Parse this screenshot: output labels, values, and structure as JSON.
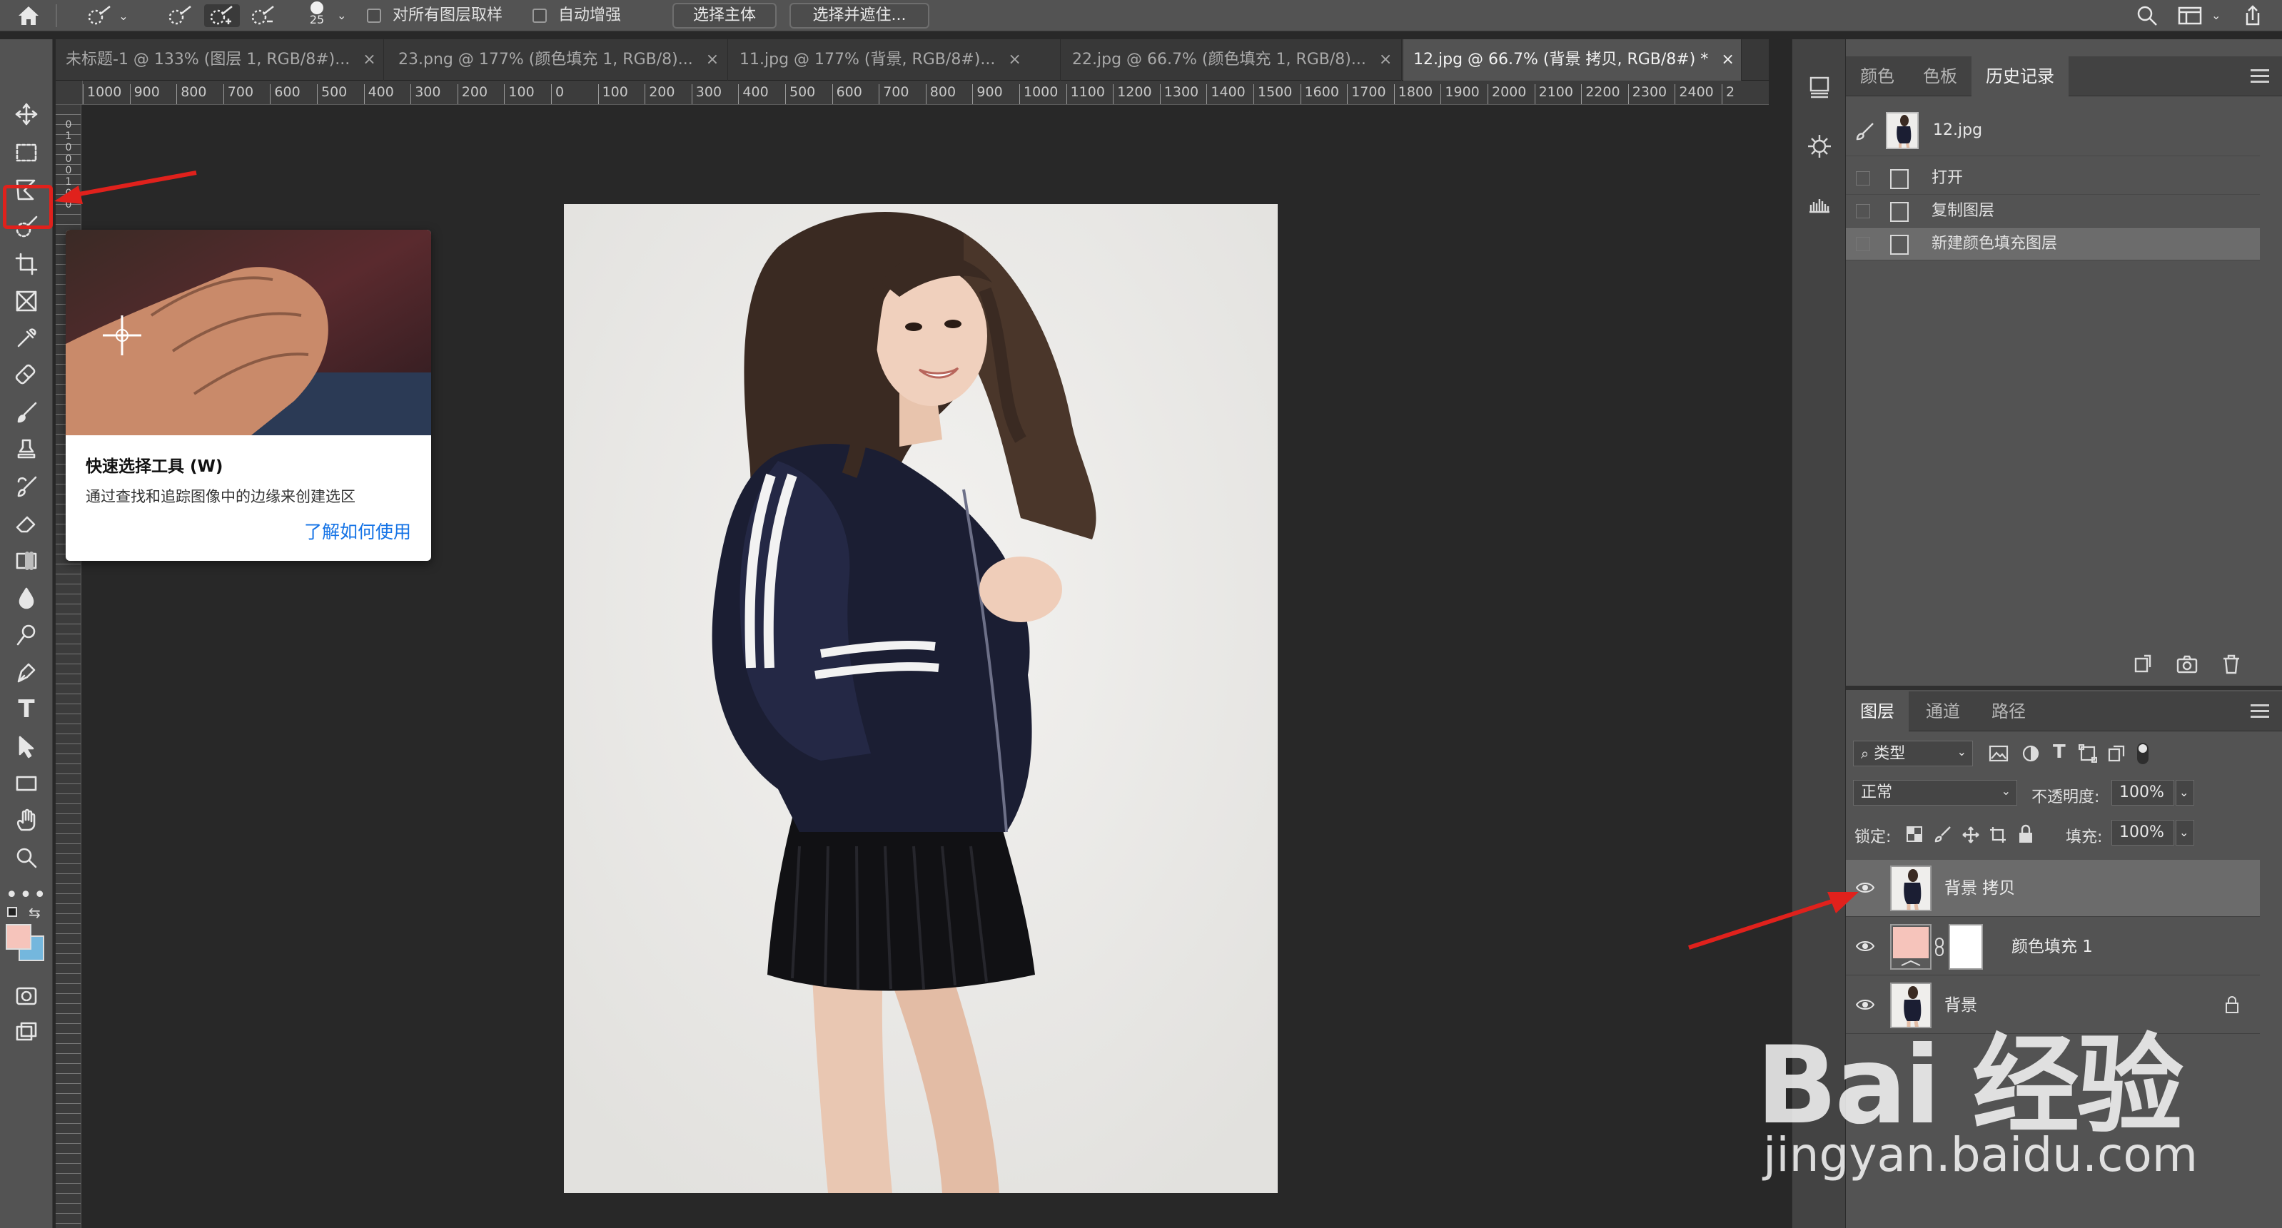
{
  "options_bar": {
    "brush_size": "25",
    "sample_all_layers_label": "对所有图层取样",
    "auto_enhance_label": "自动增强",
    "select_subject_label": "选择主体",
    "select_and_mask_label": "选择并遮住..."
  },
  "tabs": [
    {
      "label": "未标题-1 @ 133% (图层 1, RGB/8#)...",
      "close": "×"
    },
    {
      "label": "23.png @ 177% (颜色填充 1, RGB/8)...",
      "close": "×"
    },
    {
      "label": "11.jpg @ 177% (背景, RGB/8#)...",
      "close": "×"
    },
    {
      "label": "22.jpg @ 66.7% (颜色填充 1, RGB/8)...",
      "close": "×"
    },
    {
      "label": "12.jpg @ 66.7% (背景 拷贝, RGB/8#) *",
      "close": "×"
    }
  ],
  "ruler": {
    "h_ticks": [
      "1000",
      "900",
      "800",
      "700",
      "600",
      "500",
      "400",
      "300",
      "200",
      "100",
      "0",
      "100",
      "200",
      "300",
      "400",
      "500",
      "600",
      "700",
      "800",
      "900",
      "1000",
      "1100",
      "1200",
      "1300",
      "1400",
      "1500",
      "1600",
      "1700",
      "1800",
      "1900",
      "2000",
      "2100",
      "2200",
      "2300",
      "2400",
      "2"
    ],
    "v_ticks": [
      "0",
      "1",
      "0",
      "0",
      "0",
      "1",
      "0",
      "0"
    ]
  },
  "tooltip": {
    "title": "快速选择工具 (W)",
    "description": "通过查找和追踪图像中的边缘来创建选区",
    "link": "了解如何使用"
  },
  "colors": {
    "foreground": "#f6c4bb",
    "background": "#74b7dd",
    "highlight_red": "#e0211c",
    "link_blue": "#1473e6"
  },
  "history_panel": {
    "tabs": [
      "颜色",
      "色板",
      "历史记录"
    ],
    "active_tab": "历史记录",
    "snapshot": "12.jpg",
    "items": [
      "打开",
      "复制图层",
      "新建颜色填充图层"
    ]
  },
  "layers_panel": {
    "tabs": [
      "图层",
      "通道",
      "路径"
    ],
    "active_tab": "图层",
    "filter_label": "类型",
    "blend_mode": "正常",
    "opacity_label": "不透明度:",
    "opacity_value": "100%",
    "lock_label": "锁定:",
    "fill_label": "填充:",
    "fill_value": "100%",
    "layers": [
      {
        "name": "背景 拷贝",
        "selected": true
      },
      {
        "name": "颜色填充 1",
        "selected": false
      },
      {
        "name": "背景",
        "selected": false
      }
    ]
  },
  "watermark": {
    "brand": "Bai 经验",
    "url": "jingyan.baidu.com"
  }
}
